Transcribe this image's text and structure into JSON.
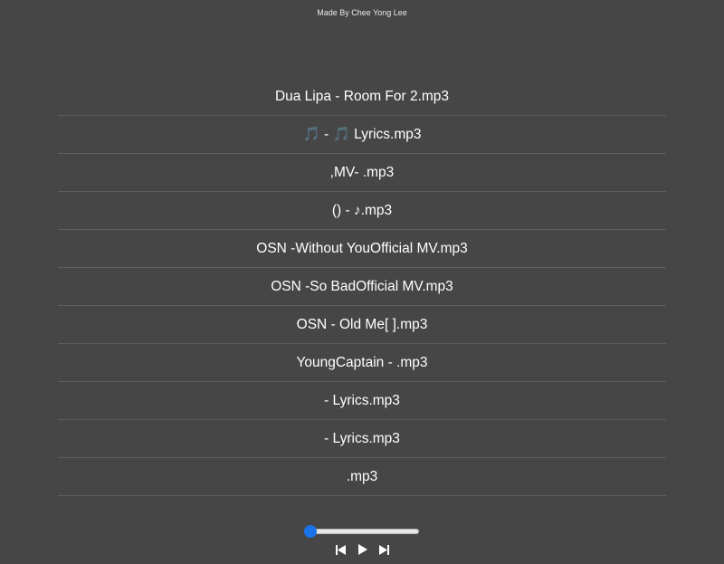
{
  "credit": "Made By Chee Yong Lee",
  "playlist": {
    "tracks": [
      {
        "label": "Dua Lipa - Room For 2.mp3"
      },
      {
        "label": "🎵 - 🎵 Lyrics.mp3"
      },
      {
        "label": " ,MV-  .mp3"
      },
      {
        "label": "() -  ♪.mp3"
      },
      {
        "label": " OSN -Without YouOfficial MV.mp3"
      },
      {
        "label": " OSN -So BadOfficial MV.mp3"
      },
      {
        "label": " OSN - Old Me[  ].mp3"
      },
      {
        "label": "YoungCaptain -  .mp3"
      },
      {
        "label": " - Lyrics.mp3"
      },
      {
        "label": " - Lyrics.mp3"
      },
      {
        "label": ".mp3"
      }
    ]
  },
  "player": {
    "progress": 0,
    "accent": "#1a73e8",
    "icons": [
      "skip-previous-icon",
      "play-icon",
      "skip-next-icon"
    ]
  }
}
